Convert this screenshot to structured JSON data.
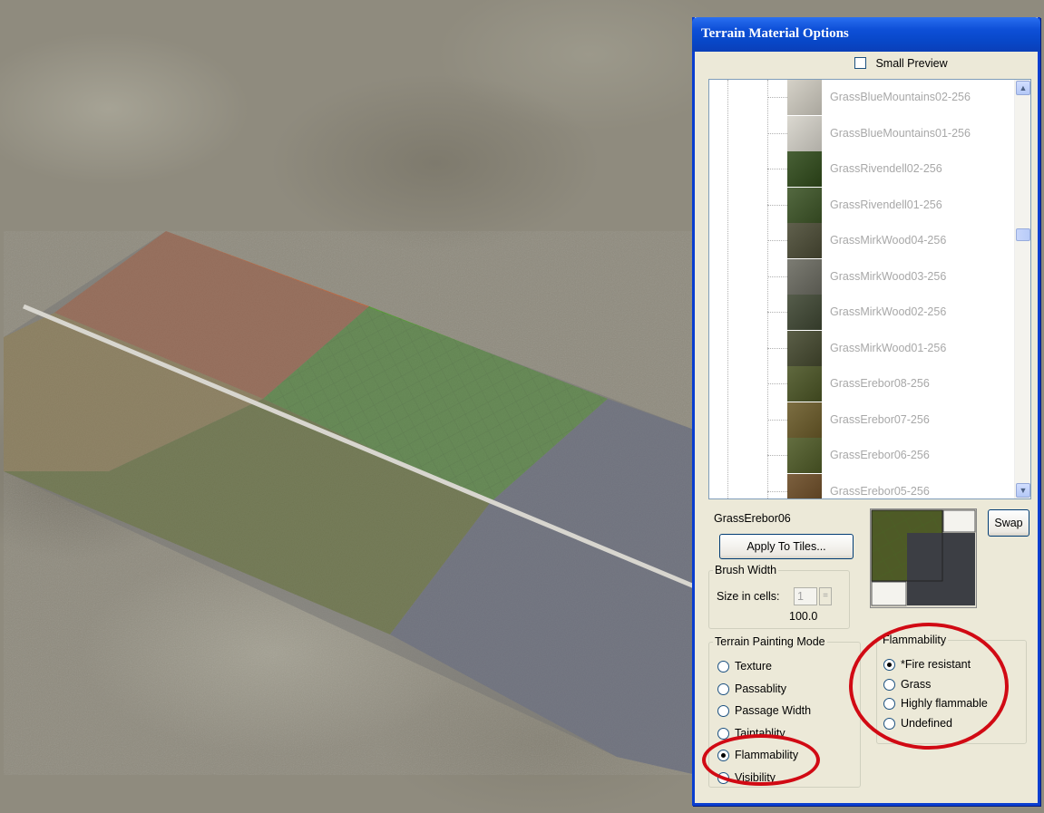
{
  "viewport": {
    "tiles": [
      {
        "name": "clay-tile",
        "color": "#b8623a"
      },
      {
        "name": "green-grid-tile",
        "color": "#4e9a2a"
      },
      {
        "name": "dry-grass-tile",
        "color": "#a48a4a"
      },
      {
        "name": "grass-tile",
        "color": "#6c7a2c"
      },
      {
        "name": "stone-tile",
        "color": "#6a7088"
      }
    ]
  },
  "dialog": {
    "title": "Terrain Material Options",
    "small_preview_label": "Small Preview",
    "small_preview_checked": false,
    "texture_list": [
      {
        "label": "GrassBlueMountains02-256",
        "color": "#cfcbc0"
      },
      {
        "label": "GrassBlueMountains01-256",
        "color": "#d6d3ca"
      },
      {
        "label": "GrassRivendell02-256",
        "color": "#2f4a1a"
      },
      {
        "label": "GrassRivendell01-256",
        "color": "#3c5426"
      },
      {
        "label": "GrassMirkWood04-256",
        "color": "#4a4a34"
      },
      {
        "label": "GrassMirkWood03-256",
        "color": "#6a6a60"
      },
      {
        "label": "GrassMirkWood02-256",
        "color": "#3e4632"
      },
      {
        "label": "GrassMirkWood01-256",
        "color": "#44482e"
      },
      {
        "label": "GrassErebor08-256",
        "color": "#4a5424"
      },
      {
        "label": "GrassErebor07-256",
        "color": "#6a5a28"
      },
      {
        "label": "GrassErebor06-256",
        "color": "#4e5a26"
      },
      {
        "label": "GrassErebor05-256",
        "color": "#6a4a24"
      }
    ],
    "scroll_up_icon": "▲",
    "scroll_down_icon": "▼",
    "selected_texture": "GrassErebor06",
    "apply_button": "Apply To Tiles...",
    "swap_button": "Swap",
    "brush": {
      "legend": "Brush Width",
      "size_label": "Size in cells:",
      "size_value": "1",
      "value_readout": "100.0"
    },
    "painting_mode": {
      "legend": "Terrain Painting Mode",
      "options": [
        "Texture",
        "Passablity",
        "Passage Width",
        "Taintablity",
        "Flammability",
        "Visibility"
      ],
      "selected": "Flammability"
    },
    "flammability": {
      "legend": "Flammability",
      "options": [
        "*Fire resistant",
        "Grass",
        "Highly flammable",
        "Undefined"
      ],
      "selected": "*Fire resistant"
    },
    "highlight_color": "#d10a14"
  }
}
